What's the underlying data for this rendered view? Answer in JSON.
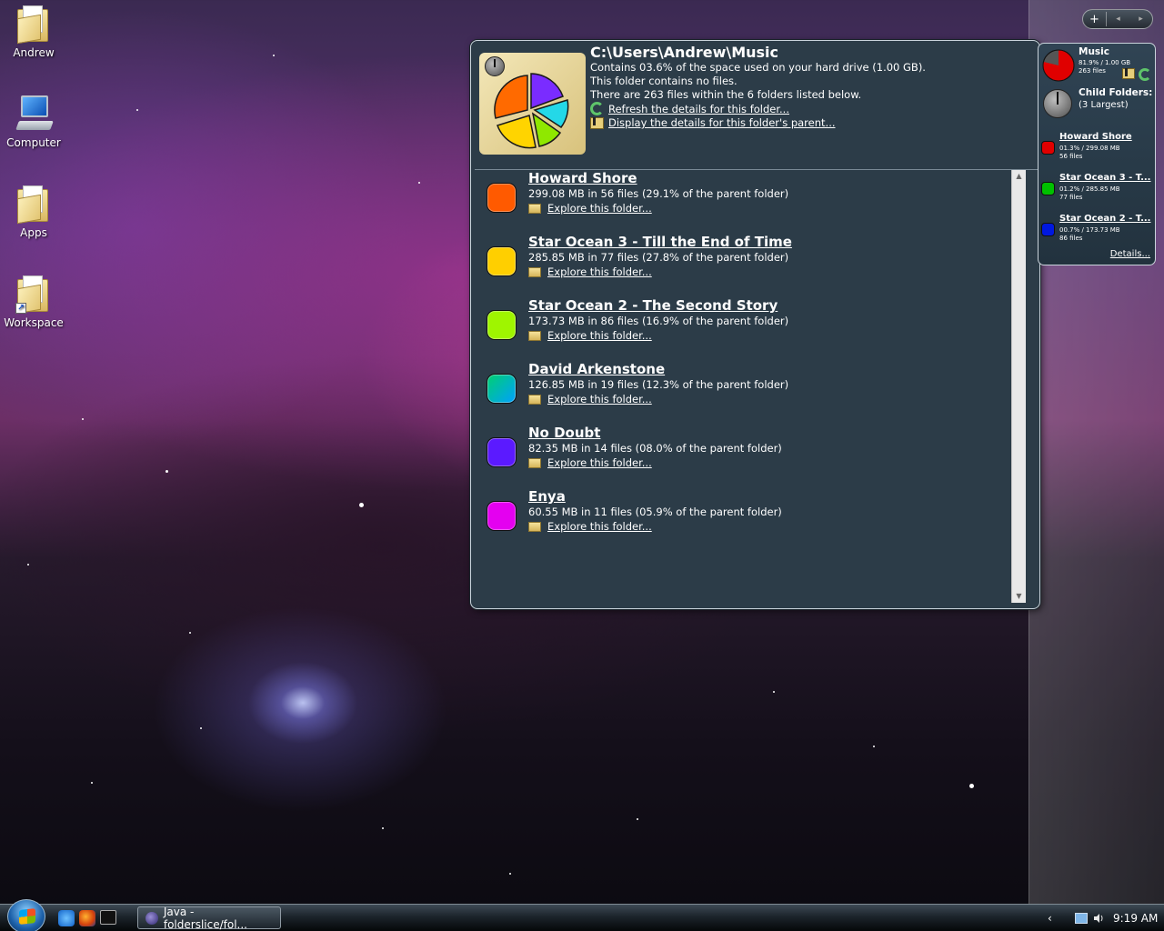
{
  "desktop": {
    "icons": [
      {
        "label": "Andrew"
      },
      {
        "label": "Computer"
      },
      {
        "label": "Apps"
      },
      {
        "label": "Workspace"
      }
    ]
  },
  "sidebar_controls": {
    "add": "+",
    "prev": "◂",
    "next": "▸"
  },
  "flyout": {
    "path": "C:\\Users\\Andrew\\Music",
    "line1": "Contains 03.6% of the space used on your hard drive (1.00 GB).",
    "line2": "This folder contains no files.",
    "line3": "There are 263 files within the 6 folders listed below.",
    "refresh_link": "Refresh the details for this folder...",
    "parent_link": "Display the details for this folder's parent...",
    "explore_label": "Explore this folder...",
    "items": [
      {
        "name": "Howard Shore",
        "detail": "299.08 MB in 56 files (29.1% of the parent folder)",
        "color": "#ff5a00"
      },
      {
        "name": "Star Ocean 3 - Till the End of Time",
        "detail": "285.85 MB in 77 files (27.8% of the parent folder)",
        "color": "#ffcf00"
      },
      {
        "name": "Star Ocean 2 - The Second Story",
        "detail": "173.73 MB in 86 files (16.9% of the parent folder)",
        "color": "#9ff500"
      },
      {
        "name": "David Arkenstone",
        "detail": "126.85 MB in 19 files (12.3% of the parent folder)",
        "color": "#00b7e0"
      },
      {
        "name": "No Doubt",
        "detail": "82.35 MB in 14 files (08.0% of the parent folder)",
        "color": "#5b1aff"
      },
      {
        "name": "Enya",
        "detail": "60.55 MB in 11 files (05.9% of the parent folder)",
        "color": "#e400f0"
      }
    ]
  },
  "gadget": {
    "title": "Music",
    "usage": "81.9% / 1.00 GB",
    "files": "263 files",
    "child_title": "Child Folders:",
    "child_sub": "(3 Largest)",
    "entries": [
      {
        "name": "Howard Shore",
        "usage": "01.3% / 299.08 MB",
        "files": "56 files",
        "color": "#e00000"
      },
      {
        "name": "Star Ocean 3 - T...",
        "usage": "01.2% / 285.85 MB",
        "files": "77 files",
        "color": "#00c000"
      },
      {
        "name": "Star Ocean 2 - T...",
        "usage": "00.7% / 173.73 MB",
        "files": "86 files",
        "color": "#0018e0"
      }
    ],
    "details_link": "Details..."
  },
  "taskbar": {
    "task_label": "Java - folderslice/fol...",
    "clock": "9:19 AM",
    "tray_chevron": "‹"
  }
}
